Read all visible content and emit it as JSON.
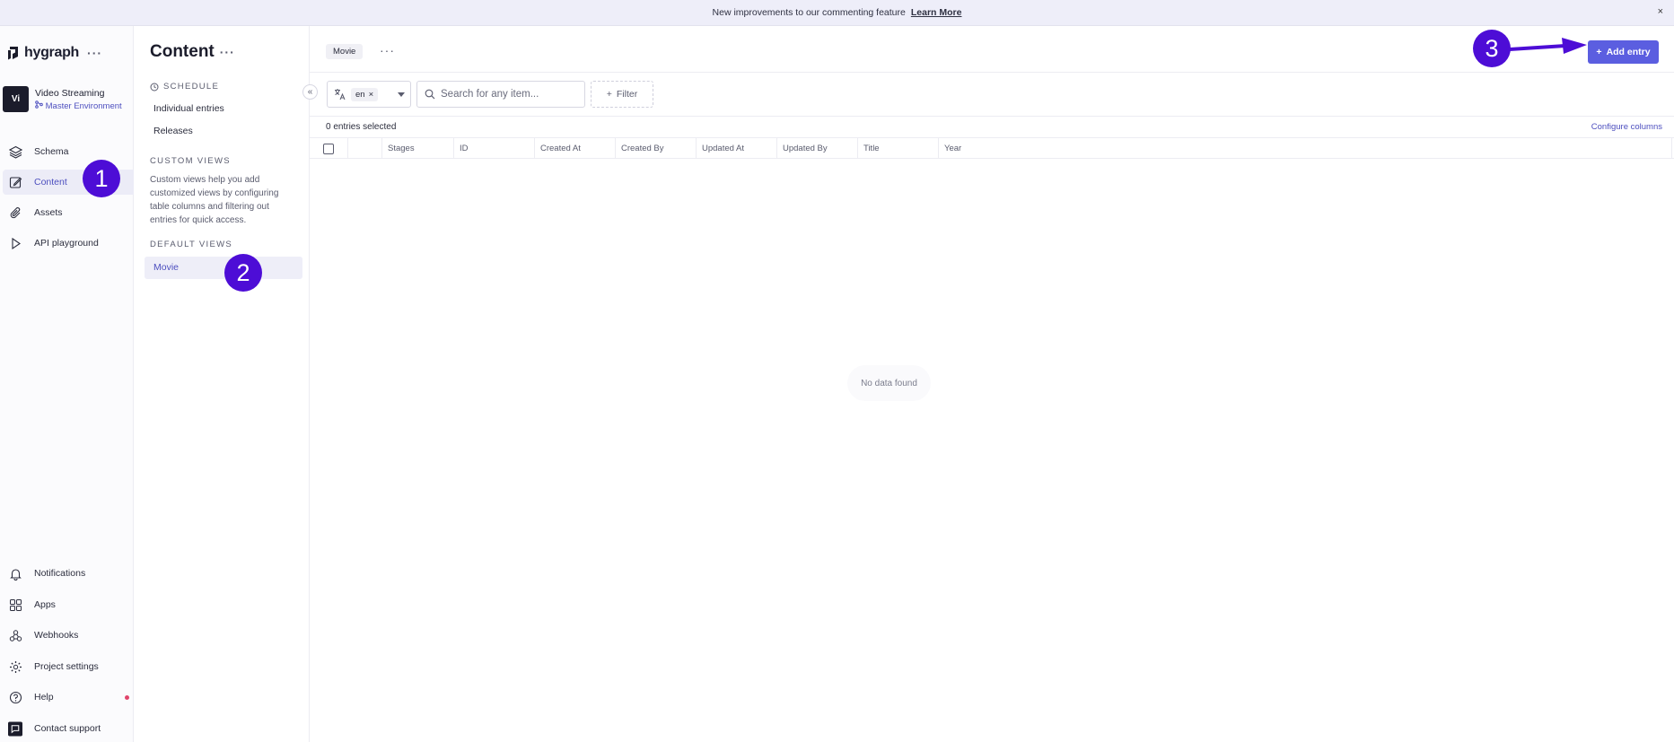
{
  "announcement": {
    "text": "New improvements to our commenting feature",
    "link": "Learn More",
    "close": "×"
  },
  "brand": {
    "name": "hygraph",
    "more": "···"
  },
  "project": {
    "initials": "Vi",
    "name": "Video Streaming",
    "environment": "Master Environment"
  },
  "nav": {
    "top": [
      {
        "label": "Schema",
        "icon": "layers-icon"
      },
      {
        "label": "Content",
        "icon": "edit-icon",
        "active": true
      },
      {
        "label": "Assets",
        "icon": "paperclip-icon"
      },
      {
        "label": "API playground",
        "icon": "play-icon"
      }
    ],
    "bottom": [
      {
        "label": "Notifications",
        "icon": "bell-icon"
      },
      {
        "label": "Apps",
        "icon": "apps-grid-icon"
      },
      {
        "label": "Webhooks",
        "icon": "webhook-icon"
      },
      {
        "label": "Project settings",
        "icon": "gear-icon"
      },
      {
        "label": "Help",
        "icon": "help-circle-icon"
      },
      {
        "label": "Contact support",
        "icon": "chat-icon"
      }
    ]
  },
  "panel": {
    "title": "Content",
    "more": "···",
    "schedule_heading": "SCHEDULE",
    "individual_entries": "Individual entries",
    "releases": "Releases",
    "custom_views_heading": "CUSTOM VIEWS",
    "custom_views_desc": "Custom views help you add customized views by configuring table columns and filtering out entries for quick access.",
    "default_views_heading": "DEFAULT VIEWS",
    "default_view_item": "Movie",
    "collapse": "«"
  },
  "main": {
    "model_chip": "Movie",
    "more": "···",
    "add_entry": "Add entry",
    "locale_tag": "en",
    "search_placeholder": "Search for any item...",
    "filter": "Filter",
    "entries_selected": "0 entries selected",
    "configure_columns": "Configure columns",
    "columns": [
      "Stages",
      "ID",
      "Created At",
      "Created By",
      "Updated At",
      "Updated By",
      "Title",
      "Year"
    ],
    "empty_state": "No data found"
  },
  "annotations": [
    "1",
    "2",
    "3"
  ],
  "colors": {
    "accent": "#5b5ee0",
    "annotation": "#4d0dd6",
    "active_bg": "#ececf7"
  }
}
